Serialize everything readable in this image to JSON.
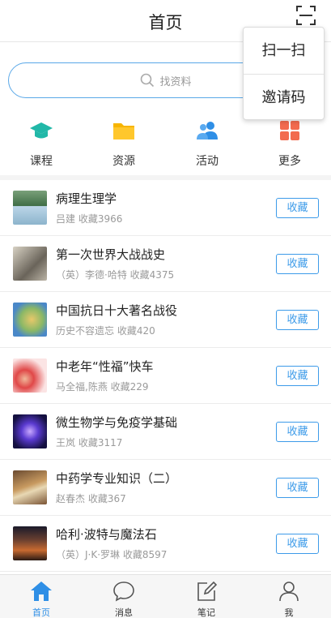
{
  "header": {
    "title": "首页",
    "scan_icon": "scan-icon"
  },
  "search": {
    "placeholder": "找资料",
    "icon": "search-icon",
    "accent": "#5aa8e8"
  },
  "quick_nav": [
    {
      "label": "课程",
      "icon": "graduation-cap-icon",
      "color": "#21b8a8"
    },
    {
      "label": "资源",
      "icon": "folder-icon",
      "color": "#f7b500"
    },
    {
      "label": "活动",
      "icon": "people-icon",
      "color": "#2f8fe6"
    },
    {
      "label": "更多",
      "icon": "grid-icon",
      "color": "#f26b4f"
    }
  ],
  "list": [
    {
      "title": "病理生理学",
      "author": "吕建",
      "favs": "收藏3966",
      "button": "收藏"
    },
    {
      "title": "第一次世界大战战史",
      "author": "（英）李德·哈特",
      "favs": "收藏4375",
      "button": "收藏"
    },
    {
      "title": "中国抗日十大著名战役",
      "author": "历史不容遗忘",
      "favs": "收藏420",
      "button": "收藏"
    },
    {
      "title": "中老年“性福”快车",
      "author": "马全福,陈燕",
      "favs": "收藏229",
      "button": "收藏"
    },
    {
      "title": "微生物学与免疫学基础",
      "author": "王岚",
      "favs": "收藏3117",
      "button": "收藏"
    },
    {
      "title": "中药学专业知识（二）",
      "author": "赵春杰",
      "favs": "收藏367",
      "button": "收藏"
    },
    {
      "title": "哈利·波特与魔法石",
      "author": "（英）J·K·罗琳",
      "favs": "收藏8597",
      "button": "收藏"
    }
  ],
  "tabs": [
    {
      "label": "首页",
      "icon": "home-icon",
      "active": true
    },
    {
      "label": "消息",
      "icon": "message-icon",
      "active": false
    },
    {
      "label": "笔记",
      "icon": "note-icon",
      "active": false
    },
    {
      "label": "我",
      "icon": "person-icon",
      "active": false
    }
  ],
  "popup": {
    "items": [
      "扫一扫",
      "邀请码"
    ]
  },
  "colors": {
    "accent": "#3d9be9",
    "active_tab": "#2f8fe6"
  }
}
